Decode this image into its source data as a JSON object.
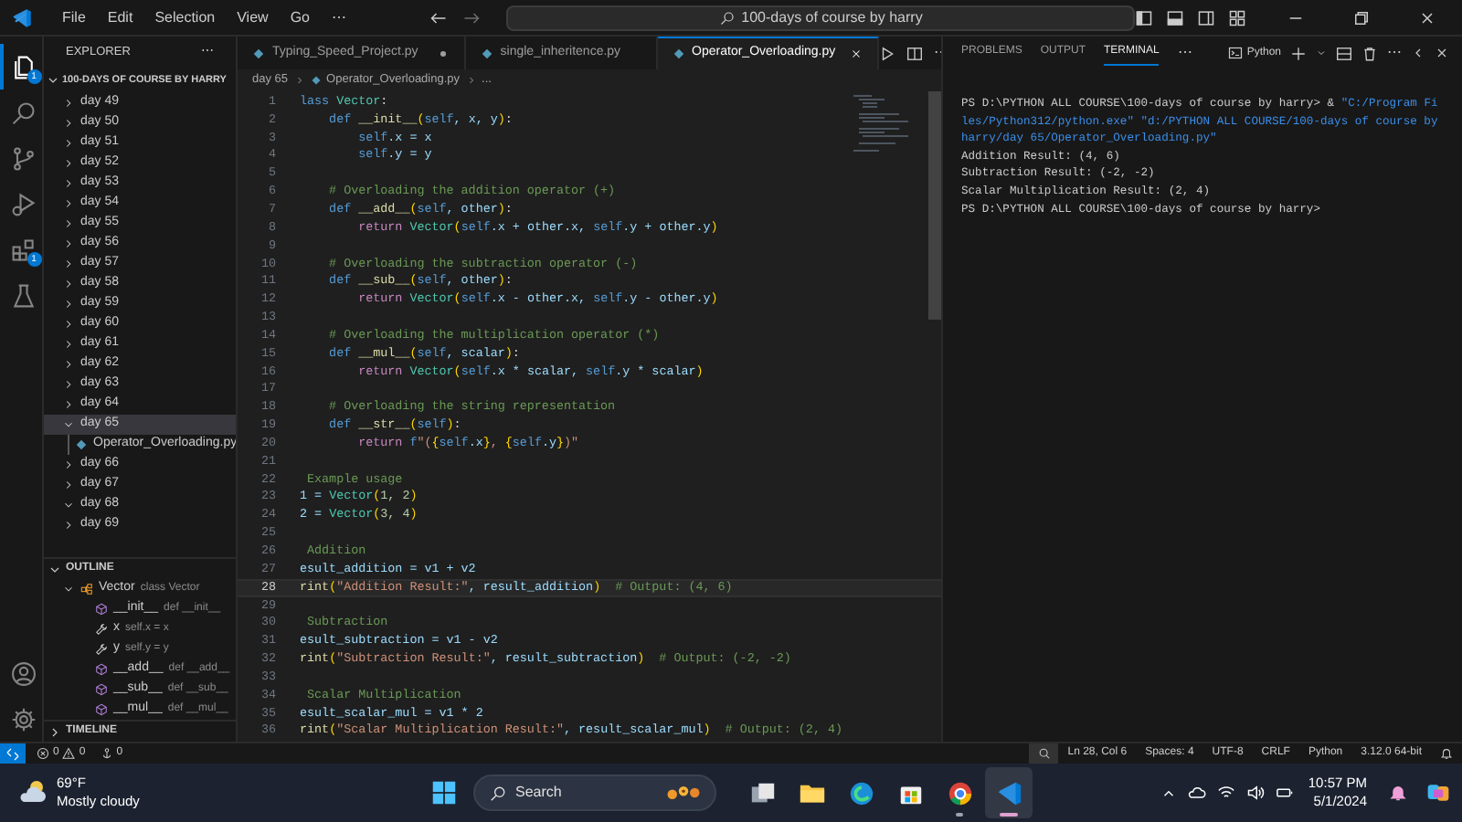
{
  "title_bar": {
    "menus": [
      "File",
      "Edit",
      "Selection",
      "View",
      "Go",
      "⋯"
    ],
    "search": "100-days of course by harry"
  },
  "activity_bar": {
    "items": [
      {
        "kind": "explorer",
        "selected": true,
        "badge": "1"
      },
      {
        "kind": "search",
        "selected": false
      },
      {
        "kind": "source-control",
        "selected": false
      },
      {
        "kind": "run",
        "selected": false
      },
      {
        "kind": "extensions",
        "selected": false,
        "badge": "1"
      },
      {
        "kind": "testing",
        "selected": false
      }
    ],
    "bottom": [
      {
        "kind": "account"
      },
      {
        "kind": "settings"
      }
    ]
  },
  "sidebar": {
    "title": "EXPLORER",
    "more": "⋯",
    "root": {
      "label": "100-DAYS OF COURSE BY HARRY",
      "expanded": true
    },
    "items": [
      {
        "label": "day 49",
        "expanded": false,
        "selected": false
      },
      {
        "label": "day 50",
        "expanded": false,
        "selected": false
      },
      {
        "label": "day 51",
        "expanded": false,
        "selected": false
      },
      {
        "label": "day 52",
        "expanded": false,
        "selected": false
      },
      {
        "label": "day 53",
        "expanded": false,
        "selected": false
      },
      {
        "label": "day 54",
        "expanded": false,
        "selected": false
      },
      {
        "label": "day 55",
        "expanded": false,
        "selected": false
      },
      {
        "label": "day 56",
        "expanded": false,
        "selected": false
      },
      {
        "label": "day 57",
        "expanded": false,
        "selected": false
      },
      {
        "label": "day 58",
        "expanded": false,
        "selected": false
      },
      {
        "label": "day 59",
        "expanded": false,
        "selected": false
      },
      {
        "label": "day 60",
        "expanded": false,
        "selected": false
      },
      {
        "label": "day 61",
        "expanded": false,
        "selected": false
      },
      {
        "label": "day 62",
        "expanded": false,
        "selected": false
      },
      {
        "label": "day 63",
        "expanded": false,
        "selected": false
      },
      {
        "label": "day 64",
        "expanded": false,
        "selected": false
      },
      {
        "label": "day 65",
        "expanded": true,
        "selected": true,
        "children": [
          {
            "label": "Operator_Overloading.py",
            "selected": false
          }
        ]
      },
      {
        "label": "day 66",
        "expanded": false,
        "selected": false
      },
      {
        "label": "day 67",
        "expanded": false,
        "selected": false
      },
      {
        "label": "day 68",
        "expanded": true,
        "selected": false
      },
      {
        "label": "day 69",
        "expanded": false,
        "selected": false
      }
    ],
    "outline": {
      "title": "OUTLINE",
      "expanded": true,
      "items": [
        {
          "name": "Vector",
          "detail": "class Vector",
          "kind": "class",
          "expanded": true,
          "children": [
            {
              "name": "__init__",
              "detail": "def __init__",
              "kind": "method"
            },
            {
              "name": "x",
              "detail": "self.x = x",
              "kind": "field"
            },
            {
              "name": "y",
              "detail": "self.y = y",
              "kind": "field"
            },
            {
              "name": "__add__",
              "detail": "def __add__",
              "kind": "method"
            },
            {
              "name": "__sub__",
              "detail": "def __sub__",
              "kind": "method"
            },
            {
              "name": "__mul__",
              "detail": "def __mul__",
              "kind": "method"
            }
          ]
        }
      ]
    },
    "timeline": {
      "title": "TIMELINE",
      "expanded": false
    }
  },
  "tabs": [
    {
      "label": "Typing_Speed_Project.py",
      "modified": true,
      "selected": false
    },
    {
      "label": "single_inheritence.py",
      "modified": false,
      "selected": false
    },
    {
      "label": "Operator_Overloading.py",
      "modified": false,
      "selected": true
    }
  ],
  "editor_more": "⋯",
  "breadcrumb": [
    "day 65",
    "Operator_Overloading.py",
    "..."
  ],
  "code": {
    "lines": [
      {
        "n": "1",
        "current": false,
        "tokens": [
          {
            "text": "lass ",
            "kind": "kw"
          },
          {
            "text": "Vector",
            "kind": "cls"
          },
          {
            "text": ":",
            "kind": "p"
          }
        ]
      },
      {
        "n": "2",
        "current": false,
        "tokens": [
          {
            "text": "    def ",
            "kind": "kw"
          },
          {
            "text": "__init__",
            "kind": "fn"
          },
          {
            "text": "(",
            "kind": "br"
          },
          {
            "text": "self",
            "kind": "kw"
          },
          {
            "text": ", x, y",
            "kind": "var"
          },
          {
            "text": ")",
            "kind": "br"
          },
          {
            "text": ":",
            "kind": "p"
          }
        ]
      },
      {
        "n": "3",
        "current": false,
        "tokens": [
          {
            "text": "        self",
            "kind": "kw"
          },
          {
            "text": ".x = x",
            "kind": "var"
          }
        ]
      },
      {
        "n": "4",
        "current": false,
        "tokens": [
          {
            "text": "        self",
            "kind": "kw"
          },
          {
            "text": ".y = y",
            "kind": "var"
          }
        ]
      },
      {
        "n": "5",
        "current": false
      },
      {
        "n": "6",
        "current": false,
        "tokens": [
          {
            "text": "    # Overloading the addition operator (+)",
            "kind": "cmt"
          }
        ]
      },
      {
        "n": "7",
        "current": false,
        "tokens": [
          {
            "text": "    def ",
            "kind": "kw"
          },
          {
            "text": "__add__",
            "kind": "fn"
          },
          {
            "text": "(",
            "kind": "br"
          },
          {
            "text": "self",
            "kind": "kw"
          },
          {
            "text": ", other",
            "kind": "var"
          },
          {
            "text": ")",
            "kind": "br"
          },
          {
            "text": ":",
            "kind": "p"
          }
        ]
      },
      {
        "n": "8",
        "current": false,
        "tokens": [
          {
            "text": "        return ",
            "kind": "ctl"
          },
          {
            "text": "Vector",
            "kind": "cls"
          },
          {
            "text": "(",
            "kind": "br"
          },
          {
            "text": "self",
            "kind": "kw"
          },
          {
            "text": ".x + other.x, ",
            "kind": "var"
          },
          {
            "text": "self",
            "kind": "kw"
          },
          {
            "text": ".y + other.y",
            "kind": "var"
          },
          {
            "text": ")",
            "kind": "br"
          }
        ]
      },
      {
        "n": "9",
        "current": false
      },
      {
        "n": "10",
        "current": false,
        "tokens": [
          {
            "text": "    # Overloading the subtraction operator (-)",
            "kind": "cmt"
          }
        ]
      },
      {
        "n": "11",
        "current": false,
        "tokens": [
          {
            "text": "    def ",
            "kind": "kw"
          },
          {
            "text": "__sub__",
            "kind": "fn"
          },
          {
            "text": "(",
            "kind": "br"
          },
          {
            "text": "self",
            "kind": "kw"
          },
          {
            "text": ", other",
            "kind": "var"
          },
          {
            "text": ")",
            "kind": "br"
          },
          {
            "text": ":",
            "kind": "p"
          }
        ]
      },
      {
        "n": "12",
        "current": false,
        "tokens": [
          {
            "text": "        return ",
            "kind": "ctl"
          },
          {
            "text": "Vector",
            "kind": "cls"
          },
          {
            "text": "(",
            "kind": "br"
          },
          {
            "text": "self",
            "kind": "kw"
          },
          {
            "text": ".x - other.x, ",
            "kind": "var"
          },
          {
            "text": "self",
            "kind": "kw"
          },
          {
            "text": ".y - other.y",
            "kind": "var"
          },
          {
            "text": ")",
            "kind": "br"
          }
        ]
      },
      {
        "n": "13",
        "current": false
      },
      {
        "n": "14",
        "current": false,
        "tokens": [
          {
            "text": "    # Overloading the multiplication operator (*)",
            "kind": "cmt"
          }
        ]
      },
      {
        "n": "15",
        "current": false,
        "tokens": [
          {
            "text": "    def ",
            "kind": "kw"
          },
          {
            "text": "__mul__",
            "kind": "fn"
          },
          {
            "text": "(",
            "kind": "br"
          },
          {
            "text": "self",
            "kind": "kw"
          },
          {
            "text": ", scalar",
            "kind": "var"
          },
          {
            "text": ")",
            "kind": "br"
          },
          {
            "text": ":",
            "kind": "p"
          }
        ]
      },
      {
        "n": "16",
        "current": false,
        "tokens": [
          {
            "text": "        return ",
            "kind": "ctl"
          },
          {
            "text": "Vector",
            "kind": "cls"
          },
          {
            "text": "(",
            "kind": "br"
          },
          {
            "text": "self",
            "kind": "kw"
          },
          {
            "text": ".x * scalar, ",
            "kind": "var"
          },
          {
            "text": "self",
            "kind": "kw"
          },
          {
            "text": ".y * scalar",
            "kind": "var"
          },
          {
            "text": ")",
            "kind": "br"
          }
        ]
      },
      {
        "n": "17",
        "current": false
      },
      {
        "n": "18",
        "current": false,
        "tokens": [
          {
            "text": "    # Overloading the string representation",
            "kind": "cmt"
          }
        ]
      },
      {
        "n": "19",
        "current": false,
        "tokens": [
          {
            "text": "    def ",
            "kind": "kw"
          },
          {
            "text": "__str__",
            "kind": "fn"
          },
          {
            "text": "(",
            "kind": "br"
          },
          {
            "text": "self",
            "kind": "kw"
          },
          {
            "text": ")",
            "kind": "br"
          },
          {
            "text": ":",
            "kind": "p"
          }
        ]
      },
      {
        "n": "20",
        "current": false,
        "tokens": [
          {
            "text": "        return ",
            "kind": "ctl"
          },
          {
            "text": "f",
            "kind": "kw"
          },
          {
            "text": "\"(",
            "kind": "str"
          },
          {
            "text": "{",
            "kind": "br"
          },
          {
            "text": "self",
            "kind": "kw"
          },
          {
            "text": ".x",
            "kind": "var"
          },
          {
            "text": "}",
            "kind": "br"
          },
          {
            "text": ", ",
            "kind": "str"
          },
          {
            "text": "{",
            "kind": "br"
          },
          {
            "text": "self",
            "kind": "kw"
          },
          {
            "text": ".y",
            "kind": "var"
          },
          {
            "text": "}",
            "kind": "br"
          },
          {
            "text": ")\"",
            "kind": "str"
          }
        ]
      },
      {
        "n": "21",
        "current": false
      },
      {
        "n": "22",
        "current": false,
        "tokens": [
          {
            "text": " Example usage",
            "kind": "cmt"
          }
        ]
      },
      {
        "n": "23",
        "current": false,
        "tokens": [
          {
            "text": "1 = ",
            "kind": "var"
          },
          {
            "text": "Vector",
            "kind": "cls"
          },
          {
            "text": "(",
            "kind": "br"
          },
          {
            "text": "1, 2",
            "kind": "num"
          },
          {
            "text": ")",
            "kind": "br"
          }
        ]
      },
      {
        "n": "24",
        "current": false,
        "tokens": [
          {
            "text": "2 = ",
            "kind": "var"
          },
          {
            "text": "Vector",
            "kind": "cls"
          },
          {
            "text": "(",
            "kind": "br"
          },
          {
            "text": "3, 4",
            "kind": "num"
          },
          {
            "text": ")",
            "kind": "br"
          }
        ]
      },
      {
        "n": "25",
        "current": false
      },
      {
        "n": "26",
        "current": false,
        "tokens": [
          {
            "text": " Addition",
            "kind": "cmt"
          }
        ]
      },
      {
        "n": "27",
        "current": false,
        "tokens": [
          {
            "text": "esult_addition = v1 + v2",
            "kind": "var"
          }
        ]
      },
      {
        "n": "28",
        "current": true,
        "tokens": [
          {
            "text": "rint",
            "kind": "fn"
          },
          {
            "text": "(",
            "kind": "br"
          },
          {
            "text": "\"Addition Result:\"",
            "kind": "str"
          },
          {
            "text": ", result_addition",
            "kind": "var"
          },
          {
            "text": ")",
            "kind": "br"
          },
          {
            "text": "  # Output: (4, 6)",
            "kind": "cmt"
          }
        ]
      },
      {
        "n": "29",
        "current": false
      },
      {
        "n": "30",
        "current": false,
        "tokens": [
          {
            "text": " Subtraction",
            "kind": "cmt"
          }
        ]
      },
      {
        "n": "31",
        "current": false,
        "tokens": [
          {
            "text": "esult_subtraction = v1 - v2",
            "kind": "var"
          }
        ]
      },
      {
        "n": "32",
        "current": false,
        "tokens": [
          {
            "text": "rint",
            "kind": "fn"
          },
          {
            "text": "(",
            "kind": "br"
          },
          {
            "text": "\"Subtraction Result:\"",
            "kind": "str"
          },
          {
            "text": ", result_subtraction",
            "kind": "var"
          },
          {
            "text": ")",
            "kind": "br"
          },
          {
            "text": "  # Output: (-2, -2)",
            "kind": "cmt"
          }
        ]
      },
      {
        "n": "33",
        "current": false
      },
      {
        "n": "34",
        "current": false,
        "tokens": [
          {
            "text": " Scalar Multiplication",
            "kind": "cmt"
          }
        ]
      },
      {
        "n": "35",
        "current": false,
        "tokens": [
          {
            "text": "esult_scalar_mul = v1 * 2",
            "kind": "var"
          }
        ]
      },
      {
        "n": "36",
        "current": false,
        "tokens": [
          {
            "text": "rint",
            "kind": "fn"
          },
          {
            "text": "(",
            "kind": "br"
          },
          {
            "text": "\"Scalar Multiplication Result:\"",
            "kind": "str"
          },
          {
            "text": ", result_scalar_mul",
            "kind": "var"
          },
          {
            "text": ")",
            "kind": "br"
          },
          {
            "text": "  # Output: (2, 4)",
            "kind": "cmt"
          }
        ]
      }
    ]
  },
  "panel": {
    "tabs": [
      {
        "label": "PROBLEMS",
        "selected": false
      },
      {
        "label": "OUTPUT",
        "selected": false
      },
      {
        "label": "TERMINAL",
        "selected": true
      }
    ],
    "more": "⋯",
    "terminal_name": "Python",
    "actions_more": "⋯",
    "terminal": [
      {
        "kind": "command",
        "prompt": "PS D:\\PYTHON ALL COURSE\\100-days of course by harry> & ",
        "args": "\"C:/Program Files/Python312/python.exe\" \"d:/PYTHON ALL COURSE/100-days of course by harry/day 65/Operator_Overloading.py\""
      },
      {
        "kind": "output",
        "text": "Addition Result: (4, 6)"
      },
      {
        "kind": "output",
        "text": "Subtraction Result: (-2, -2)"
      },
      {
        "kind": "output",
        "text": "Scalar Multiplication Result: (2, 4)"
      },
      {
        "kind": "output",
        "text": "PS D:\\PYTHON ALL COURSE\\100-days of course by harry>"
      }
    ]
  },
  "status_bar": {
    "errors": "0",
    "warnings": "0",
    "ports": "0",
    "items": [
      "Ln 28, Col 6",
      "Spaces: 4",
      "UTF-8",
      "CRLF",
      "Python",
      "3.12.0 64-bit"
    ]
  },
  "taskbar": {
    "weather": {
      "temperature": "69°F",
      "condition": "Mostly cloudy"
    },
    "search": "Search",
    "apps": [
      {
        "kind": "task-view",
        "running": false,
        "active": false
      },
      {
        "kind": "files",
        "running": false,
        "active": false
      },
      {
        "kind": "edge",
        "running": false,
        "active": false
      },
      {
        "kind": "store",
        "running": false,
        "active": false
      },
      {
        "kind": "chrome",
        "running": true,
        "active": false
      },
      {
        "kind": "vscode",
        "running": true,
        "active": true
      }
    ],
    "time": "10:57 PM",
    "date": "5/1/2024"
  }
}
